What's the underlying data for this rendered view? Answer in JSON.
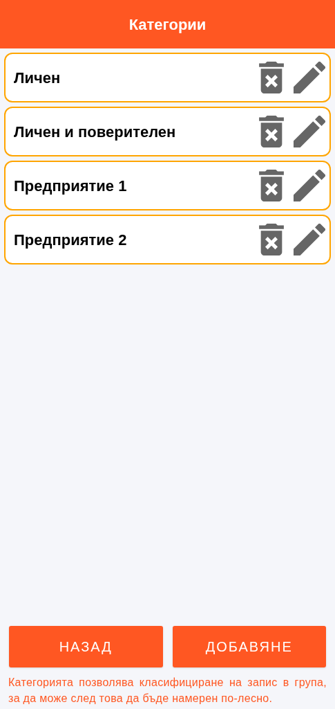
{
  "header": {
    "title": "Категории"
  },
  "categories": [
    {
      "name": "Личен"
    },
    {
      "name": "Личен и поверителен"
    },
    {
      "name": "Предприятие 1"
    },
    {
      "name": "Предприятие 2"
    }
  ],
  "buttons": [
    {
      "label": "НАЗАД"
    },
    {
      "label": "ДОБАВЯНЕ"
    }
  ],
  "footer_note": "Категорията позволява класифициране на запис в група, за да може след това да бъде намерен по-лесно."
}
